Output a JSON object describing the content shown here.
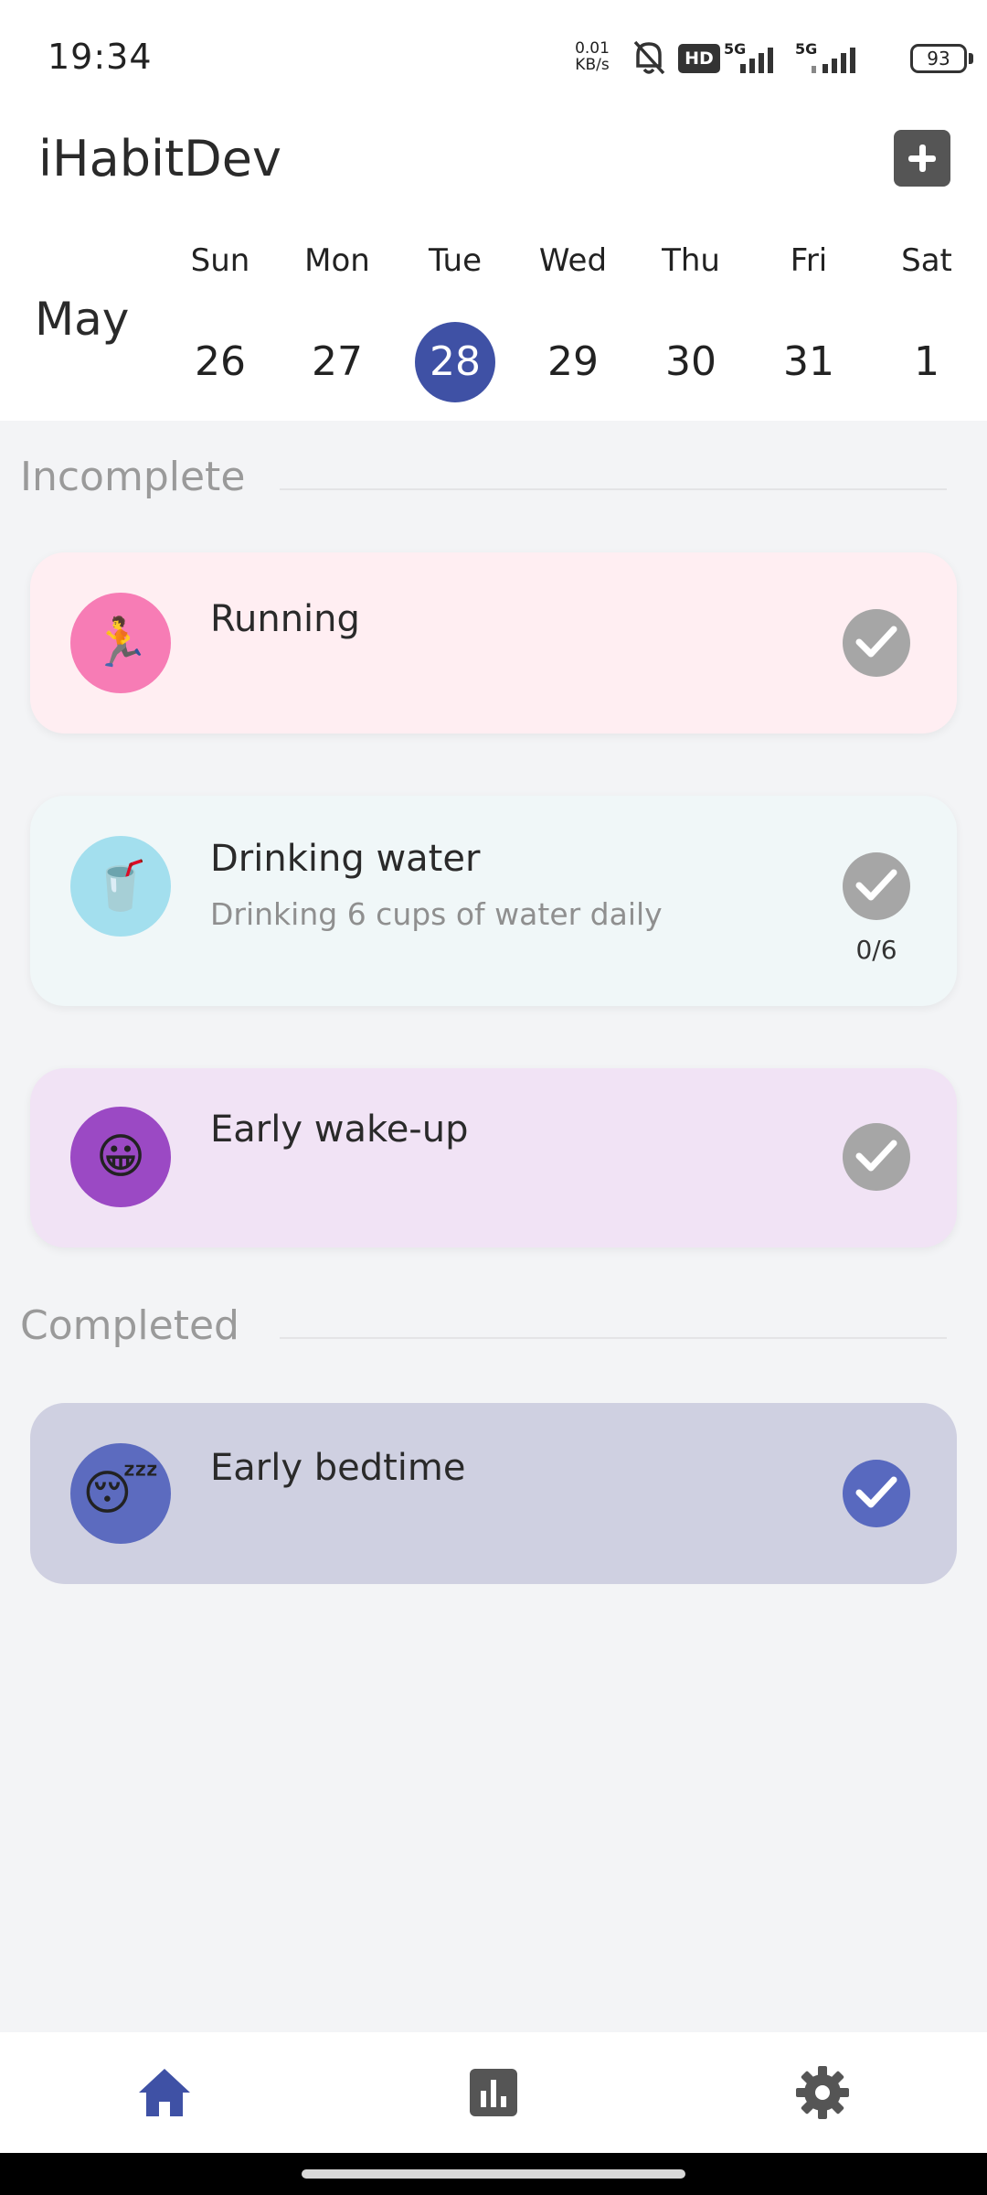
{
  "status_bar": {
    "time": "19:34",
    "net_speed_value": "0.01",
    "net_speed_unit": "KB/s",
    "hd_badge": "HD",
    "network_tag_1": "5G",
    "network_tag_2": "5G",
    "battery": "93"
  },
  "header": {
    "app_title": "iHabitDev",
    "add_button_icon": "plus-icon",
    "month": "May",
    "week": [
      {
        "day": "Sun",
        "date": "26",
        "selected": false
      },
      {
        "day": "Mon",
        "date": "27",
        "selected": false
      },
      {
        "day": "Tue",
        "date": "28",
        "selected": true
      },
      {
        "day": "Wed",
        "date": "29",
        "selected": false
      },
      {
        "day": "Thu",
        "date": "30",
        "selected": false
      },
      {
        "day": "Fri",
        "date": "31",
        "selected": false
      },
      {
        "day": "Sat",
        "date": "1",
        "selected": false
      }
    ]
  },
  "incomplete": {
    "title": "Incomplete",
    "habits": [
      {
        "name": "Running",
        "description": "",
        "emoji": "🏃",
        "card_color": "#ffeef2",
        "avatar_color": "#f77cb5",
        "done": false
      },
      {
        "name": "Drinking water",
        "description": "Drinking 6 cups of water daily",
        "emoji": "🥤",
        "card_color": "#f0f7f8",
        "avatar_color": "#a3dfee",
        "done": false,
        "progress": "0/6"
      },
      {
        "name": "Early wake-up",
        "description": "",
        "emoji": "😀",
        "card_color": "#f1e3f5",
        "avatar_color": "#9b49c4",
        "done": false
      }
    ]
  },
  "completed": {
    "title": "Completed",
    "habits": [
      {
        "name": "Early bedtime",
        "description": "",
        "emoji": "😴",
        "card_color": "#cfd0e1",
        "avatar_color": "#5c6bbf",
        "done": true
      }
    ]
  },
  "colors": {
    "accent": "#3f51a5",
    "check_inactive": "#a6a6a6",
    "check_done": "#5869bf",
    "background": "#f3f4f6"
  },
  "bottom_nav": {
    "items": [
      {
        "icon": "home-icon",
        "active": true
      },
      {
        "icon": "stats-icon",
        "active": false
      },
      {
        "icon": "gear-icon",
        "active": false
      }
    ]
  }
}
